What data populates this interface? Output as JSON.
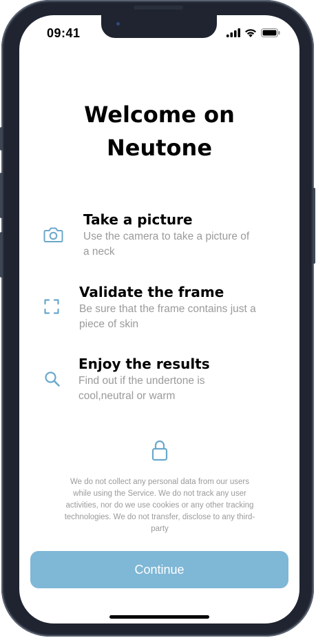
{
  "status": {
    "time": "09:41"
  },
  "header": {
    "title_line1": "Welcome on",
    "title_line2": "Neutone"
  },
  "features": [
    {
      "icon": "camera-icon",
      "title": "Take a picture",
      "desc_line1": "Use the camera to take a picture of",
      "desc_line2": "a neck"
    },
    {
      "icon": "frame-icon",
      "title": "Validate the frame",
      "desc_line1": "Be sure that the frame contains just a",
      "desc_line2": "piece of skin"
    },
    {
      "icon": "search-icon",
      "title": "Enjoy the results",
      "desc_line1": "Find out if the undertone is",
      "desc_line2": "cool,neutral or warm"
    }
  ],
  "privacy": {
    "icon": "lock-icon",
    "line1": "We do not collect any personal data from our users",
    "line2": "while using the Service. We do not track any user",
    "line3": "activities, nor do we use cookies or any other tracking",
    "line4": "technologies. We do not transfer, disclose to any third-",
    "line5": "party"
  },
  "actions": {
    "continue_label": "Continue"
  },
  "colors": {
    "accent": "#7fb7d6",
    "icon": "#6aa8cc",
    "muted_text": "#9a9a9a"
  }
}
